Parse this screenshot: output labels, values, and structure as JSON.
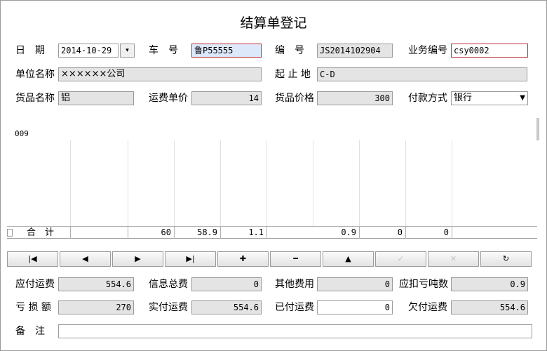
{
  "window": {
    "title": "结算单登记"
  },
  "header": {
    "date_label": "日　期",
    "date_value": "2014-10-29",
    "date_dropdown_glyph": "▾",
    "car_label": "车　号",
    "car_value": "鲁P55555",
    "code_label": "编　号",
    "code_value": "JS2014102904",
    "bizno_label": "业务编号",
    "bizno_value": "csy0002",
    "unit_label": "单位名称",
    "unit_value": "××××××公司",
    "route_label": "起 止 地",
    "route_value": "C-D",
    "goods_label": "货品名称",
    "goods_value": "铝",
    "freight_unit_label": "运费单价",
    "freight_unit_value": "14",
    "goods_price_label": "货品价格",
    "goods_price_value": "300",
    "pay_label": "付款方式",
    "pay_value": "银行"
  },
  "grid": {
    "header_text": "009",
    "total_label": "合　计",
    "totals": [
      "60",
      "58.9",
      "1.1",
      "0.9",
      "0",
      "0"
    ]
  },
  "toolbar": [
    {
      "name": "first-record-button",
      "icon": "first-icon",
      "glyph": "|◀",
      "enabled": true
    },
    {
      "name": "prev-record-button",
      "icon": "prev-icon",
      "glyph": "◀",
      "enabled": true
    },
    {
      "name": "next-record-button",
      "icon": "next-icon",
      "glyph": "▶",
      "enabled": true
    },
    {
      "name": "last-record-button",
      "icon": "last-icon",
      "glyph": "▶|",
      "enabled": true
    },
    {
      "name": "add-record-button",
      "icon": "plus-icon",
      "glyph": "✚",
      "enabled": true
    },
    {
      "name": "delete-record-button",
      "icon": "minus-icon",
      "glyph": "━",
      "enabled": true
    },
    {
      "name": "edit-record-button",
      "icon": "up-triangle-icon",
      "glyph": "▲",
      "enabled": true
    },
    {
      "name": "confirm-button",
      "icon": "check-icon",
      "glyph": "✓",
      "enabled": false
    },
    {
      "name": "cancel-button",
      "icon": "cross-icon",
      "glyph": "✕",
      "enabled": false
    },
    {
      "name": "refresh-button",
      "icon": "refresh-icon",
      "glyph": "↻",
      "enabled": true
    }
  ],
  "footer": {
    "payable_label": "应付运费",
    "payable_value": "554.6",
    "info_fee_label": "信息总费",
    "info_fee_value": "0",
    "other_fee_label": "其他费用",
    "other_fee_value": "0",
    "deduct_ton_label": "应扣亏吨数",
    "deduct_ton_value": "0.9",
    "loss_label": "亏 损 额",
    "loss_value": "270",
    "actual_label": "实付运费",
    "actual_value": "554.6",
    "paid_label": "已付运费",
    "paid_value": "0",
    "owed_label": "欠付运费",
    "owed_value": "554.6",
    "remark_label": "备　注",
    "remark_value": ""
  }
}
